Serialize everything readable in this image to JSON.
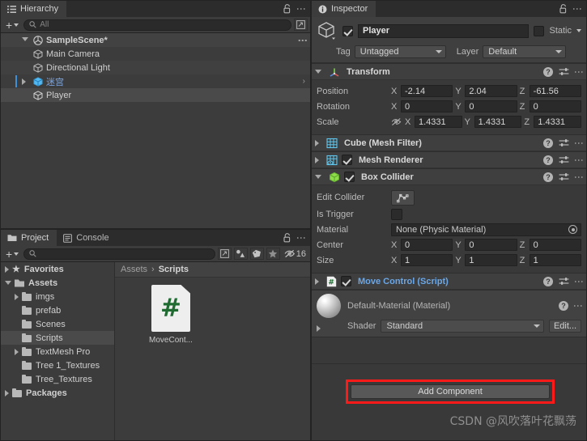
{
  "hierarchy": {
    "tab_label": "Hierarchy",
    "lock_icon": "lock-open-icon",
    "menu_icon": "kebab-menu-icon",
    "toolbar": {
      "add_label": "+",
      "search_placeholder": "All",
      "search_icon": "search-icon",
      "window_icon": "open-in-window-icon"
    },
    "rows": [
      {
        "label": "SampleScene*",
        "icon": "unity-scene-icon",
        "depth": 0,
        "expanded": true,
        "selected": false,
        "kebab": true
      },
      {
        "label": "Main Camera",
        "icon": "gameobject-cube-icon",
        "depth": 1,
        "expanded": null,
        "selected": false,
        "kebab": false
      },
      {
        "label": "Directional Light",
        "icon": "gameobject-cube-icon",
        "depth": 1,
        "expanded": null,
        "selected": false,
        "kebab": false
      },
      {
        "label": "迷宫",
        "icon": "prefab-cube-icon",
        "depth": 1,
        "expanded": false,
        "selected": false,
        "kebab": false
      },
      {
        "label": "Player",
        "icon": "gameobject-cube-icon",
        "depth": 1,
        "expanded": null,
        "selected": true,
        "kebab": false
      }
    ]
  },
  "project": {
    "tabs": [
      {
        "label": "Project",
        "icon": "folder-icon",
        "active": true
      },
      {
        "label": "Console",
        "icon": "console-icon",
        "active": false
      }
    ],
    "lock_icon": "lock-open-icon",
    "menu_icon": "kebab-menu-icon",
    "toolbar": {
      "add_label": "+",
      "search_placeholder": "",
      "search_icon": "search-icon",
      "window_icon": "open-in-window-icon",
      "filter_type_icon": "filter-by-type-icon",
      "filter_label_icon": "filter-by-label-icon",
      "favorite_icon": "star-icon",
      "visibility_icon": "eye-off-icon",
      "visibility_count": "16"
    },
    "tree": [
      {
        "label": "Favorites",
        "kind": "favorites",
        "depth": 0,
        "expandable": true,
        "expanded": false,
        "selected": false,
        "bold": true
      },
      {
        "label": "Assets",
        "kind": "folder-open",
        "depth": 0,
        "expandable": true,
        "expanded": true,
        "selected": false,
        "bold": true
      },
      {
        "label": "imgs",
        "kind": "folder",
        "depth": 1,
        "expandable": true,
        "expanded": false,
        "selected": false,
        "bold": false
      },
      {
        "label": "prefab",
        "kind": "folder",
        "depth": 1,
        "expandable": false,
        "expanded": false,
        "selected": false,
        "bold": false
      },
      {
        "label": "Scenes",
        "kind": "folder",
        "depth": 1,
        "expandable": false,
        "expanded": false,
        "selected": false,
        "bold": false
      },
      {
        "label": "Scripts",
        "kind": "folder",
        "depth": 1,
        "expandable": false,
        "expanded": false,
        "selected": true,
        "bold": false
      },
      {
        "label": "TextMesh Pro",
        "kind": "folder",
        "depth": 1,
        "expandable": true,
        "expanded": false,
        "selected": false,
        "bold": false
      },
      {
        "label": "Tree 1_Textures",
        "kind": "folder",
        "depth": 1,
        "expandable": false,
        "expanded": false,
        "selected": false,
        "bold": false
      },
      {
        "label": "Tree_Textures",
        "kind": "folder",
        "depth": 1,
        "expandable": false,
        "expanded": false,
        "selected": false,
        "bold": false
      },
      {
        "label": "Packages",
        "kind": "folder",
        "depth": 0,
        "expandable": true,
        "expanded": false,
        "selected": false,
        "bold": true
      }
    ],
    "breadcrumb": {
      "root": "Assets",
      "separator": "›",
      "current": "Scripts"
    },
    "assets": [
      {
        "name": "MoveCont...",
        "icon": "csharp-script-icon",
        "glyph": "#"
      }
    ]
  },
  "inspector": {
    "tab_label": "Inspector",
    "tab_icon": "info-icon",
    "lock_icon": "lock-open-icon",
    "menu_icon": "kebab-menu-icon",
    "gameobject": {
      "icon": "gameobject-cube-icon",
      "enabled": true,
      "name": "Player",
      "static_label": "Static",
      "static_checked": false,
      "tag_label": "Tag",
      "tag_value": "Untagged",
      "layer_label": "Layer",
      "layer_value": "Default"
    },
    "components": [
      {
        "id": "transform",
        "title": "Transform",
        "icon": "transform-axis-icon",
        "expanded": true,
        "has_toggle": false,
        "rows": [
          {
            "label": "Position",
            "axes": [
              {
                "axis": "X",
                "value": "-2.14"
              },
              {
                "axis": "Y",
                "value": "2.04"
              },
              {
                "axis": "Z",
                "value": "-61.56"
              }
            ]
          },
          {
            "label": "Rotation",
            "axes": [
              {
                "axis": "X",
                "value": "0"
              },
              {
                "axis": "Y",
                "value": "0"
              },
              {
                "axis": "Z",
                "value": "0"
              }
            ]
          },
          {
            "label": "Scale",
            "locked_icon": "constrain-proportions-off-icon",
            "axes": [
              {
                "axis": "X",
                "value": "1.4331"
              },
              {
                "axis": "Y",
                "value": "1.4331"
              },
              {
                "axis": "Z",
                "value": "1.4331"
              }
            ]
          }
        ]
      },
      {
        "id": "mesh-filter",
        "title": "Cube (Mesh Filter)",
        "icon": "mesh-filter-icon",
        "expanded": false,
        "has_toggle": false
      },
      {
        "id": "mesh-renderer",
        "title": "Mesh Renderer",
        "icon": "mesh-renderer-icon",
        "expanded": false,
        "has_toggle": true,
        "toggle_checked": true
      },
      {
        "id": "box-collider",
        "title": "Box Collider",
        "icon": "box-collider-icon",
        "expanded": true,
        "has_toggle": true,
        "toggle_checked": true
      },
      {
        "id": "move-control",
        "title": "Move Control (Script)",
        "icon": "csharp-script-icon",
        "expanded": false,
        "has_toggle": true,
        "toggle_checked": true,
        "is_script": true
      }
    ],
    "box_collider": {
      "edit_collider_label": "Edit Collider",
      "edit_collider_icon": "edit-collider-icon",
      "is_trigger_label": "Is Trigger",
      "is_trigger_checked": false,
      "material_label": "Material",
      "material_value": "None (Physic Material)",
      "material_picker_icon": "object-picker-icon",
      "center_label": "Center",
      "center": [
        {
          "axis": "X",
          "value": "0"
        },
        {
          "axis": "Y",
          "value": "0"
        },
        {
          "axis": "Z",
          "value": "0"
        }
      ],
      "size_label": "Size",
      "size": [
        {
          "axis": "X",
          "value": "1"
        },
        {
          "axis": "Y",
          "value": "1"
        },
        {
          "axis": "Z",
          "value": "1"
        }
      ]
    },
    "material_preview": {
      "title": "Default-Material (Material)",
      "preview_icon": "material-sphere-icon",
      "shader_label": "Shader",
      "shader_value": "Standard",
      "edit_label": "Edit...",
      "help_icon": "help-icon",
      "menu_icon": "kebab-menu-icon"
    },
    "add_component_label": "Add Component",
    "highlight_color": "#ff1a1a"
  },
  "watermark": "CSDN @风吹落叶花飘荡"
}
